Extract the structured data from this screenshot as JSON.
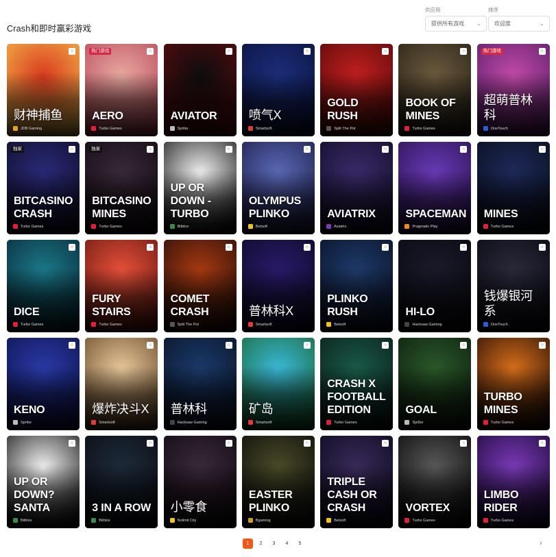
{
  "header": {
    "title": "Crash和即时赢彩游戏",
    "provider_filter": {
      "label": "供应商",
      "value": "提供所有游戏"
    },
    "sort_filter": {
      "label": "排序",
      "value": "欢迎度"
    }
  },
  "games": [
    {
      "title": "财神捕鱼",
      "provider": "JDB Gaming",
      "provider_icon": "jdb-icon",
      "provider_color": "#e8a21a",
      "badge": "",
      "cjk": true,
      "bg": [
        "#d93a1f",
        "#f2b84a"
      ]
    },
    {
      "title": "AERO",
      "provider": "Turbo Games",
      "provider_icon": "turbo-games-icon",
      "provider_color": "#e0203a",
      "badge": "热门游戏",
      "cjk": false,
      "bg": [
        "#e9a9a0",
        "#b84a5a"
      ]
    },
    {
      "title": "AVIATOR",
      "provider": "Spribe",
      "provider_icon": "spribe-icon",
      "provider_color": "#bbbbbb",
      "badge": "",
      "cjk": false,
      "bg": [
        "#0d0d0d",
        "#5a0b10"
      ]
    },
    {
      "title": "喷气X",
      "provider": "Smartsoft",
      "provider_icon": "smartsoft-icon",
      "provider_color": "#e03a3a",
      "badge": "",
      "cjk": true,
      "bg": [
        "#1b2e7a",
        "#0b1340"
      ]
    },
    {
      "title": "GOLD RUSH",
      "provider": "Split The Pot",
      "provider_icon": "split-the-pot-icon",
      "provider_color": "#555555",
      "badge": "",
      "cjk": false,
      "bg": [
        "#c11f1f",
        "#5a0a0a"
      ]
    },
    {
      "title": "BOOK OF MINES",
      "provider": "Turbo Games",
      "provider_icon": "turbo-games-icon",
      "provider_color": "#e0203a",
      "badge": "",
      "cjk": false,
      "bg": [
        "#6b5a3d",
        "#2a2218"
      ]
    },
    {
      "title": "超萌普林科",
      "provider": "OneTouch",
      "provider_icon": "onetouch-icon",
      "provider_color": "#2b5bd8",
      "badge": "热门游戏",
      "cjk": true,
      "bg": [
        "#c24aa8",
        "#5a1e6a"
      ]
    },
    {
      "title": "BITCASINO CRASH",
      "provider": "Turbo Games",
      "provider_icon": "turbo-games-icon",
      "provider_color": "#e0203a",
      "badge": "独家",
      "cjk": false,
      "bg": [
        "#2a2a7a",
        "#0e0e2a"
      ]
    },
    {
      "title": "BITCASINO MINES",
      "provider": "Turbo Games",
      "provider_icon": "turbo-games-icon",
      "provider_color": "#e0203a",
      "badge": "独家",
      "cjk": false,
      "bg": [
        "#3a2a3a",
        "#120a12"
      ]
    },
    {
      "title": "UP OR DOWN - TURBO",
      "provider": "Bitblox",
      "provider_icon": "bitblox-icon",
      "provider_color": "#3a8a4a",
      "badge": "",
      "cjk": false,
      "bg": [
        "#f2f2f2",
        "#1a1a1a"
      ]
    },
    {
      "title": "OLYMPUS PLINKO",
      "provider": "Betsoft",
      "provider_icon": "betsoft-icon",
      "provider_color": "#f2c21a",
      "badge": "",
      "cjk": false,
      "bg": [
        "#5a6ab8",
        "#1e1e4a"
      ]
    },
    {
      "title": "AVIATRIX",
      "provider": "Aviatrix",
      "provider_icon": "aviatrix-icon",
      "provider_color": "#7a3ab8",
      "badge": "",
      "cjk": false,
      "bg": [
        "#3a2a6a",
        "#150d2a"
      ]
    },
    {
      "title": "SPACEMAN",
      "provider": "Pragmatic Play",
      "provider_icon": "pragmatic-play-icon",
      "provider_color": "#f28a1a",
      "badge": "",
      "cjk": false,
      "bg": [
        "#6a3ab8",
        "#2a1250"
      ]
    },
    {
      "title": "MINES",
      "provider": "Turbo Games",
      "provider_icon": "turbo-games-icon",
      "provider_color": "#e0203a",
      "badge": "",
      "cjk": false,
      "bg": [
        "#1e2a5a",
        "#0a0e1e"
      ]
    },
    {
      "title": "DICE",
      "provider": "Turbo Games",
      "provider_icon": "turbo-games-icon",
      "provider_color": "#e0203a",
      "badge": "",
      "cjk": false,
      "bg": [
        "#1a7a8a",
        "#0a2a3a"
      ]
    },
    {
      "title": "FURY STAIRS",
      "provider": "Turbo Games",
      "provider_icon": "turbo-games-icon",
      "provider_color": "#e0203a",
      "badge": "",
      "cjk": false,
      "bg": [
        "#e8503a",
        "#6a1a12"
      ]
    },
    {
      "title": "COMET CRASH",
      "provider": "Split The Pot",
      "provider_icon": "split-the-pot-icon",
      "provider_color": "#555555",
      "badge": "",
      "cjk": false,
      "bg": [
        "#a83a12",
        "#2a0e08"
      ]
    },
    {
      "title": "普林科X",
      "provider": "Smartsoft",
      "provider_icon": "smartsoft-icon",
      "provider_color": "#e03a3a",
      "badge": "",
      "cjk": true,
      "bg": [
        "#2a1a6a",
        "#0d0a2a"
      ]
    },
    {
      "title": "PLINKO RUSH",
      "provider": "Betsoft",
      "provider_icon": "betsoft-icon",
      "provider_color": "#f2c21a",
      "badge": "",
      "cjk": false,
      "bg": [
        "#1e3a6a",
        "#0a1228"
      ]
    },
    {
      "title": "HI-LO",
      "provider": "Hacksaw Gaming",
      "provider_icon": "hacksaw-gaming-icon",
      "provider_color": "#444444",
      "badge": "",
      "cjk": false,
      "bg": [
        "#1a1a2a",
        "#0a0a12"
      ]
    },
    {
      "title": "钱爆银河系",
      "provider": "OneTouch",
      "provider_icon": "onetouch-icon",
      "provider_color": "#2b5bd8",
      "badge": "",
      "cjk": true,
      "bg": [
        "#2a2a3a",
        "#0a0a14"
      ]
    },
    {
      "title": "KENO",
      "provider": "Spribe",
      "provider_icon": "spribe-icon",
      "provider_color": "#bbbbbb",
      "badge": "",
      "cjk": false,
      "bg": [
        "#2a3aa8",
        "#0e1450"
      ]
    },
    {
      "title": "爆炸决斗X",
      "provider": "Smartsoft",
      "provider_icon": "smartsoft-icon",
      "provider_color": "#e03a3a",
      "badge": "",
      "cjk": true,
      "bg": [
        "#e8c89a",
        "#6a4a2a"
      ]
    },
    {
      "title": "普林科",
      "provider": "Hacksaw Gaming",
      "provider_icon": "hacksaw-gaming-icon",
      "provider_color": "#444444",
      "badge": "",
      "cjk": true,
      "bg": [
        "#1a3a6a",
        "#0a1428"
      ]
    },
    {
      "title": "矿岛",
      "provider": "Smartsoft",
      "provider_icon": "smartsoft-icon",
      "provider_color": "#e03a3a",
      "badge": "",
      "cjk": true,
      "bg": [
        "#3ab8d8",
        "#1a6a3a"
      ]
    },
    {
      "title": "CRASH X FOOTBALL EDITION",
      "provider": "Turbo Games",
      "provider_icon": "turbo-games-icon",
      "provider_color": "#e0203a",
      "badge": "",
      "cjk": false,
      "bg": [
        "#1a5a4a",
        "#0a1e1a"
      ]
    },
    {
      "title": "GOAL",
      "provider": "Spribe",
      "provider_icon": "spribe-icon",
      "provider_color": "#bbbbbb",
      "badge": "",
      "cjk": false,
      "bg": [
        "#2a5a2a",
        "#0e1e0e"
      ]
    },
    {
      "title": "TURBO MINES",
      "provider": "Turbo Games",
      "provider_icon": "turbo-games-icon",
      "provider_color": "#e0203a",
      "badge": "",
      "cjk": false,
      "bg": [
        "#d8701a",
        "#2a0e06"
      ]
    },
    {
      "title": "UP OR DOWN? SANTA",
      "provider": "Bitblox",
      "provider_icon": "bitblox-icon",
      "provider_color": "#3a8a4a",
      "badge": "",
      "cjk": false,
      "bg": [
        "#f2f2f2",
        "#1a1a1a"
      ]
    },
    {
      "title": "3 IN A ROW",
      "provider": "Bitblox",
      "provider_icon": "bitblox-icon",
      "provider_color": "#3a8a4a",
      "badge": "",
      "cjk": false,
      "bg": [
        "#1e2a3a",
        "#0a0e14"
      ]
    },
    {
      "title": "小零食",
      "provider": "Nolimit City",
      "provider_icon": "nolimit-city-icon",
      "provider_color": "#f2c21a",
      "badge": "",
      "cjk": true,
      "bg": [
        "#3a2a3a",
        "#120a12"
      ]
    },
    {
      "title": "EASTER PLINKO",
      "provider": "Bgaming",
      "provider_icon": "bgaming-icon",
      "provider_color": "#c8a21a",
      "badge": "",
      "cjk": false,
      "bg": [
        "#4a4a2a",
        "#0e0e0a"
      ]
    },
    {
      "title": "TRIPLE CASH OR CRASH",
      "provider": "Betsoft",
      "provider_icon": "betsoft-icon",
      "provider_color": "#f2c21a",
      "badge": "",
      "cjk": false,
      "bg": [
        "#3a2a5a",
        "#0e0a1e"
      ]
    },
    {
      "title": "VORTEX",
      "provider": "Turbo Games",
      "provider_icon": "turbo-games-icon",
      "provider_color": "#e0203a",
      "badge": "",
      "cjk": false,
      "bg": [
        "#5a5a5a",
        "#0a0a0a"
      ]
    },
    {
      "title": "LIMBO RIDER",
      "provider": "Turbo Games",
      "provider_icon": "turbo-games-icon",
      "provider_color": "#e0203a",
      "badge": "",
      "cjk": false,
      "bg": [
        "#7a3ab8",
        "#1e0a3a"
      ]
    }
  ],
  "pagination": {
    "pages": [
      "1",
      "2",
      "3",
      "4",
      "5"
    ],
    "current": "1",
    "next_icon": "chevron-right-icon",
    "next_glyph": "›"
  },
  "colors": {
    "accent": "#f05a14"
  }
}
